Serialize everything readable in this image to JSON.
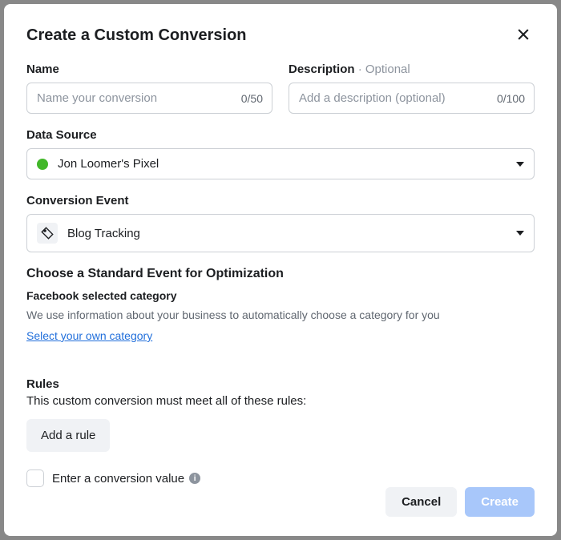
{
  "modal": {
    "title": "Create a Custom Conversion"
  },
  "name": {
    "label": "Name",
    "placeholder": "Name your conversion",
    "counter": "0/50"
  },
  "description": {
    "label": "Description",
    "optional": "Optional",
    "placeholder": "Add a description (optional)",
    "counter": "0/100"
  },
  "dataSource": {
    "label": "Data Source",
    "selected": "Jon Loomer's Pixel"
  },
  "conversionEvent": {
    "label": "Conversion Event",
    "selected": "Blog Tracking"
  },
  "optimization": {
    "heading": "Choose a Standard Event for Optimization",
    "sub": "Facebook selected category",
    "description": "We use information about your business to automatically choose a category for you",
    "link": "Select your own category"
  },
  "rules": {
    "heading": "Rules",
    "description": "This custom conversion must meet all of these rules:",
    "addButton": "Add a rule"
  },
  "conversionValue": {
    "label": "Enter a conversion value"
  },
  "footer": {
    "cancel": "Cancel",
    "create": "Create"
  }
}
